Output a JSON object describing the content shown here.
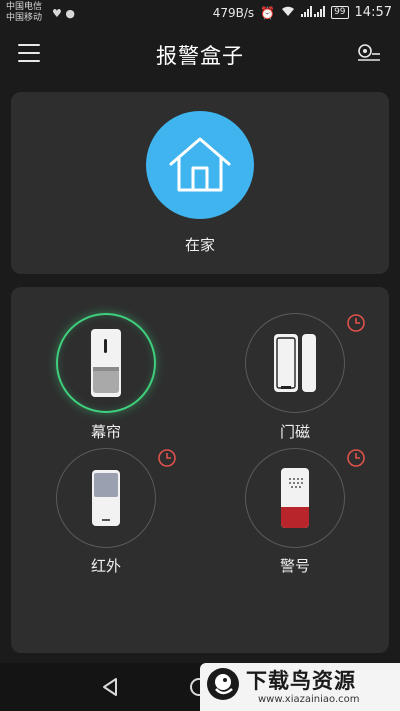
{
  "status_bar": {
    "carrier_1": "中国电信",
    "carrier_2": "中国移动",
    "net_speed": "479B/s",
    "battery": "99",
    "time": "14:57"
  },
  "header": {
    "title": "报警盒子"
  },
  "mode": {
    "label": "在家",
    "color": "#3fb4ef"
  },
  "devices": [
    {
      "label": "幕帘",
      "icon": "curtain-sensor-icon",
      "active": true,
      "timer": false
    },
    {
      "label": "门磁",
      "icon": "door-contact-icon",
      "active": false,
      "timer": true
    },
    {
      "label": "红外",
      "icon": "infrared-sensor-icon",
      "active": false,
      "timer": true
    },
    {
      "label": "警号",
      "icon": "siren-icon",
      "active": false,
      "timer": true
    }
  ],
  "colors": {
    "active_ring": "#3fd07e",
    "timer": "#e0524c",
    "panel": "#2e2e2e"
  },
  "watermark": {
    "title": "下载鸟资源",
    "url": "www.xiazainiao.com"
  }
}
